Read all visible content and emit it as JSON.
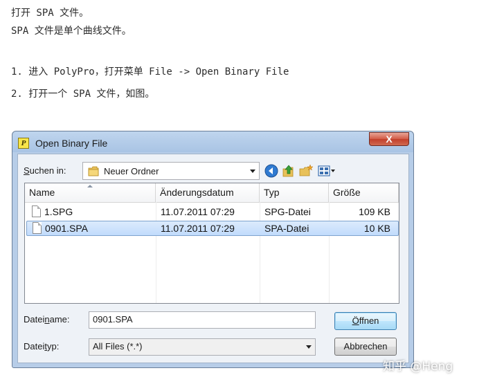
{
  "article": {
    "line1": "打开 SPA 文件。",
    "line2": "SPA 文件是单个曲线文件。",
    "step1": "1. 进入 PolyPro，打开菜单 File -> Open Binary File",
    "step2": "2. 打开一个 SPA 文件，如图。"
  },
  "dialog": {
    "title": "Open Binary File",
    "app_icon_letter": "P",
    "close_label": "X",
    "look_in_label_pre": "S",
    "look_in_label_rest": "uchen in:",
    "look_in_value": "Neuer Ordner",
    "toolbar_icons": [
      "back-icon",
      "up-folder-icon",
      "new-folder-icon",
      "view-menu-icon"
    ],
    "columns": [
      "Name",
      "Änderungsdatum",
      "Typ",
      "Größe"
    ],
    "files": [
      {
        "name": "1.SPG",
        "date": "11.07.2011 07:29",
        "type": "SPG-Datei",
        "size": "109 KB",
        "selected": false
      },
      {
        "name": "0901.SPA",
        "date": "11.07.2011 07:29",
        "type": "SPA-Datei",
        "size": "10 KB",
        "selected": true
      }
    ],
    "filename_label_pre": "Datei",
    "filename_label_ul": "n",
    "filename_label_post": "ame:",
    "filename_value": "0901.SPA",
    "filetype_label_pre": "Datei",
    "filetype_label_ul": "t",
    "filetype_label_post": "yp:",
    "filetype_value": "All Files (*.*)",
    "open_button_pre": "Ö",
    "open_button_post": "ffnen",
    "cancel_button": "Abbrechen"
  },
  "watermark": "知乎 @Heng"
}
